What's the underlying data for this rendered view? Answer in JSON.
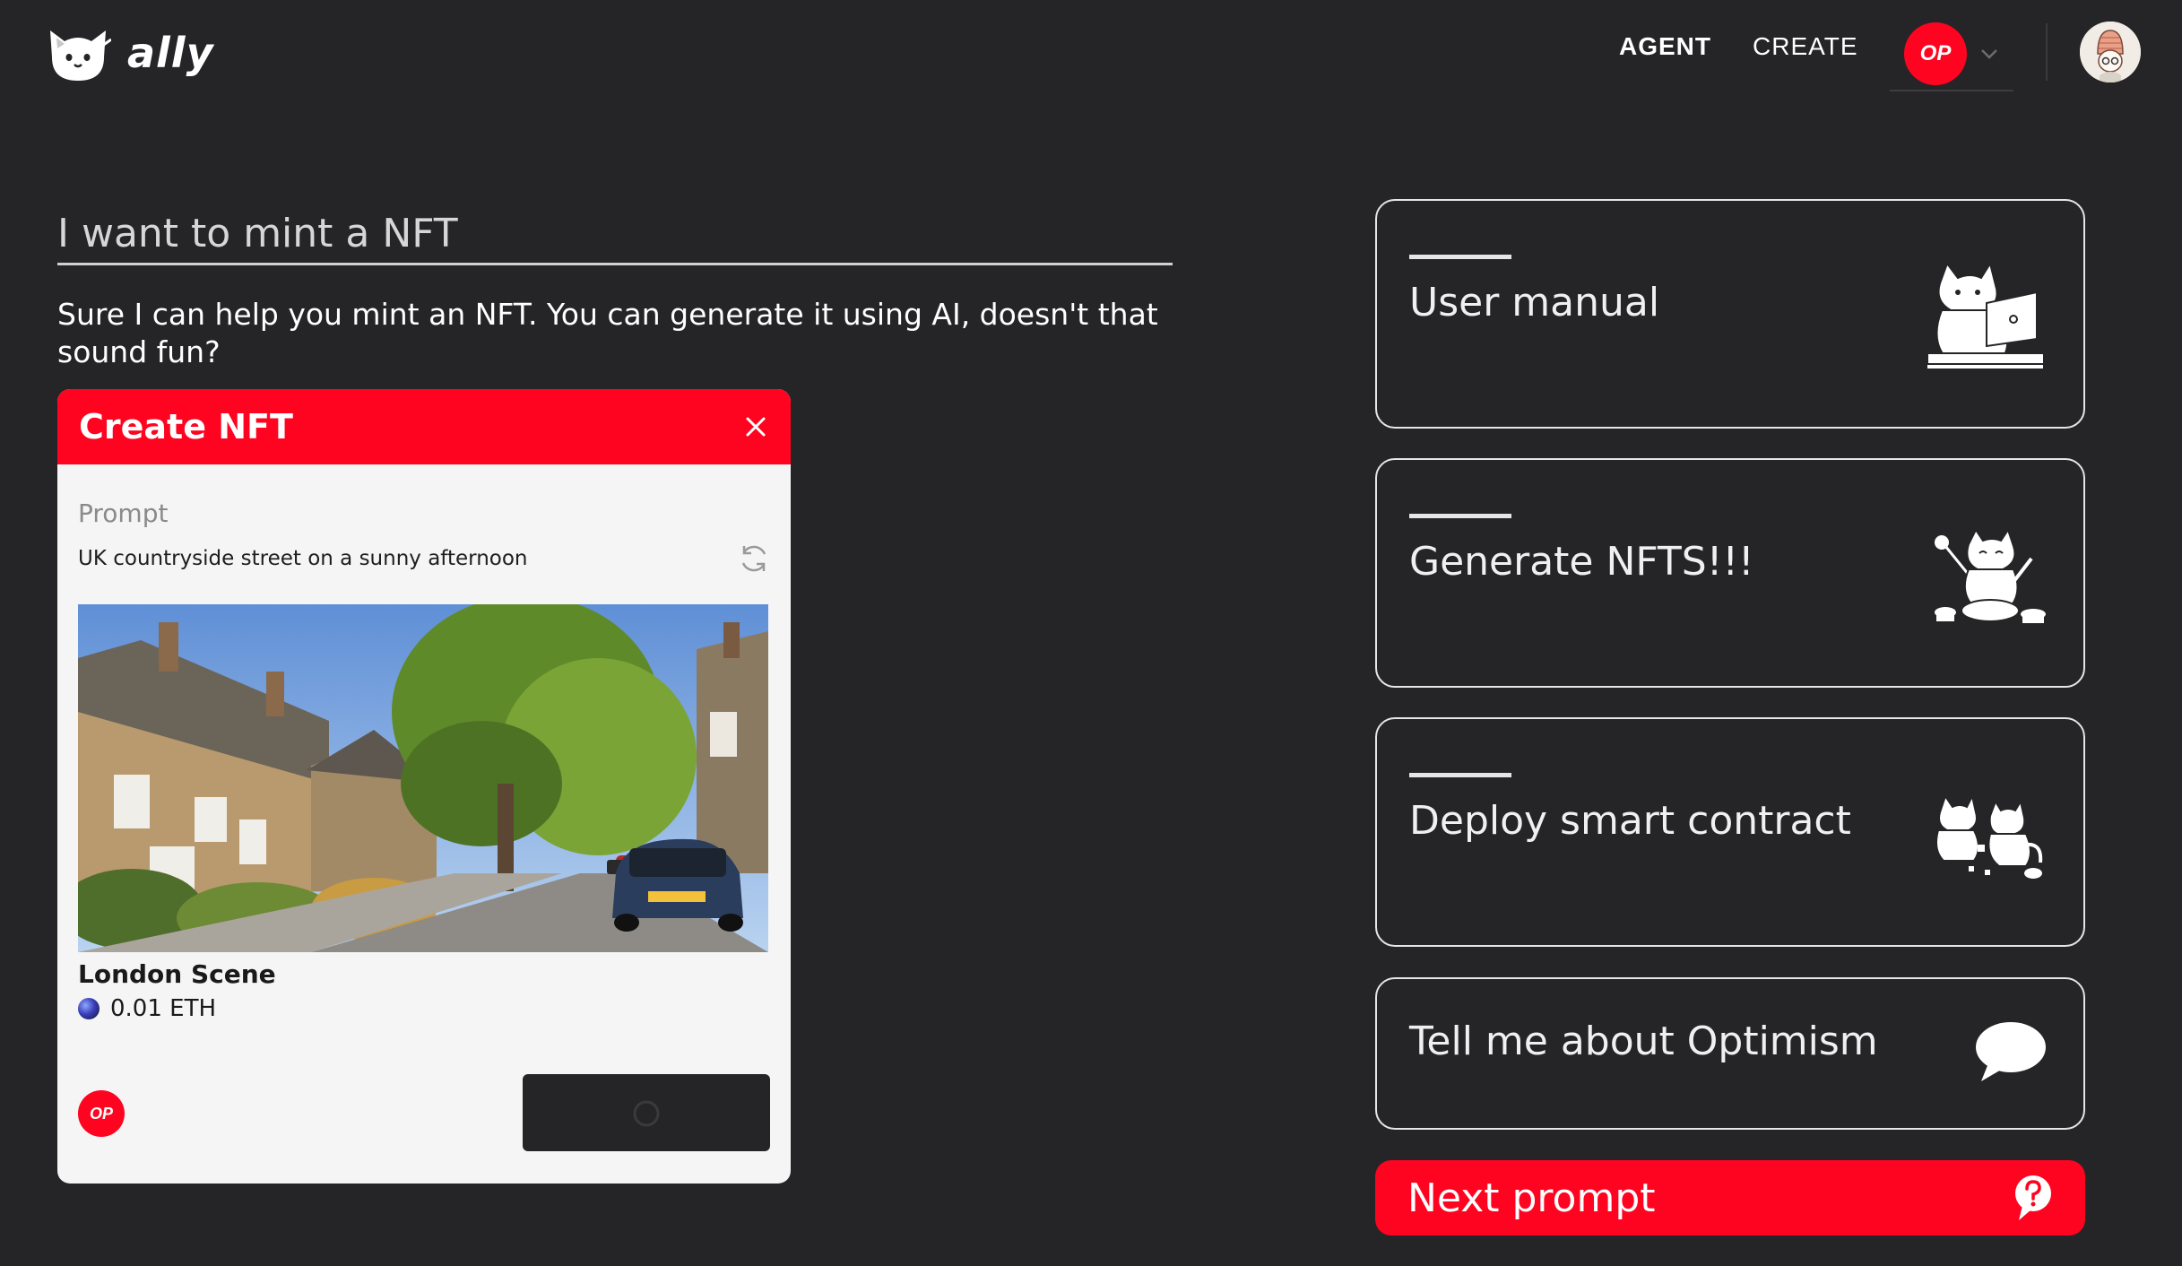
{
  "header": {
    "app_name": "ally",
    "nav": {
      "agent": "AGENT",
      "create": "CREATE"
    },
    "network_badge": "OP"
  },
  "conversation": {
    "user_prompt": "I want to mint a NFT",
    "assistant_reply": "Sure I can help you mint an NFT. You can generate it using AI, doesn't that sound fun?"
  },
  "nft_card": {
    "title": "Create NFT",
    "prompt_label": "Prompt",
    "prompt_value": "UK countryside street on a sunny afternoon",
    "nft_name": "London Scene",
    "price": "0.01 ETH",
    "network_badge": "OP"
  },
  "actions": [
    {
      "label": "User manual",
      "icon": "cat-laptop-illustration"
    },
    {
      "label": "Generate NFTS!!!",
      "icon": "cat-painting-illustration"
    },
    {
      "label": "Deploy smart contract",
      "icon": "cats-building-illustration"
    },
    {
      "label": "Tell me about Optimism",
      "icon": "speech-bubble-icon"
    }
  ],
  "next_prompt": {
    "label": "Next prompt",
    "icon": "question-bubble-icon"
  },
  "colors": {
    "background": "#252527",
    "accent": "#ff0420",
    "card": "#f5f5f5"
  }
}
